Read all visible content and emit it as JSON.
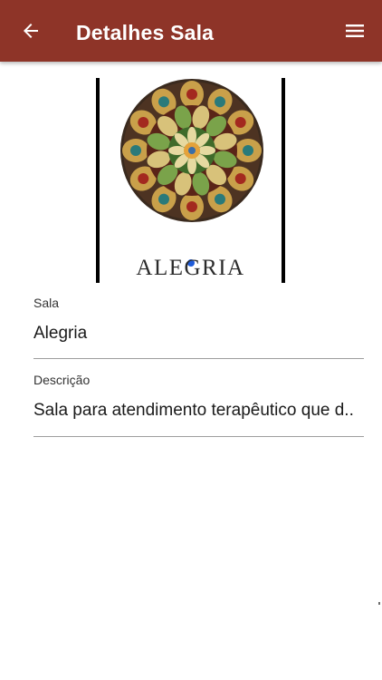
{
  "header": {
    "title": "Detalhes Sala",
    "back_icon": "arrow-back-icon",
    "menu_icon": "hamburger-menu-icon",
    "background": "#8e3428"
  },
  "image": {
    "caption": "ALEGRIA",
    "icon": "mandala-illustration"
  },
  "fields": {
    "sala": {
      "label": "Sala",
      "value": "Alegria"
    },
    "descricao": {
      "label": "Descrição",
      "value": "Sala para atendimento terapêutico que d.."
    }
  }
}
